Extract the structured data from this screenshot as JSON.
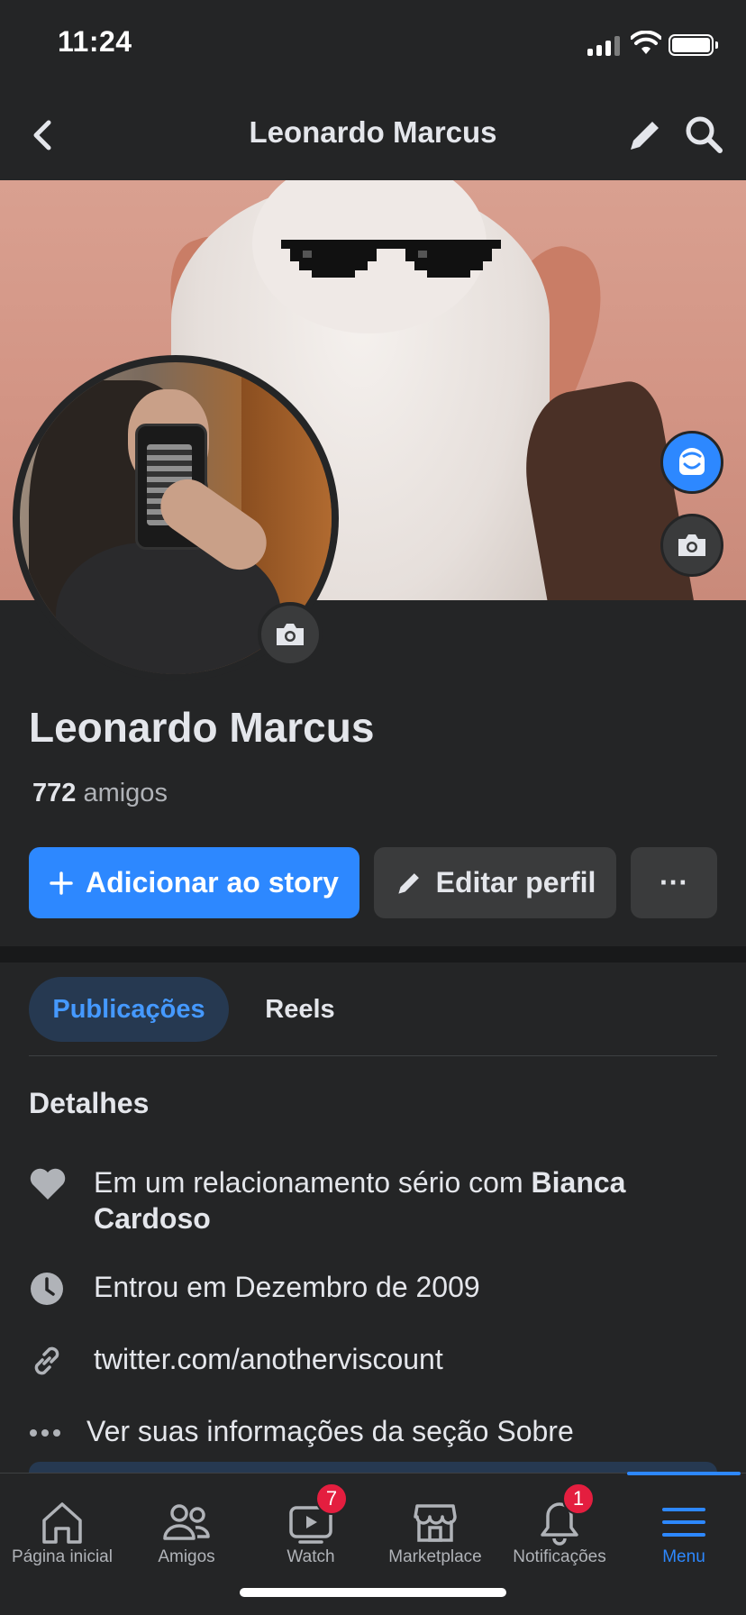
{
  "status_bar": {
    "time": "11:24"
  },
  "top_nav": {
    "title": "Leonardo Marcus",
    "back_icon": "chevron-left-icon",
    "edit_icon": "pencil-icon",
    "search_icon": "search-icon"
  },
  "profile": {
    "name": "Leonardo Marcus",
    "friends_count": "772",
    "friends_label": "amigos"
  },
  "actions": {
    "add_story_label": "Adicionar ao story",
    "edit_profile_label": "Editar perfil",
    "more_label": "···"
  },
  "tabs": [
    {
      "label": "Publicações",
      "active": true
    },
    {
      "label": "Reels",
      "active": false
    }
  ],
  "details": {
    "title": "Detalhes",
    "relationship_prefix": "Em um relacionamento sério com",
    "relationship_partner": "Bianca Cardoso",
    "joined": "Entrou em Dezembro de 2009",
    "link": "twitter.com/anotherviscount",
    "about": "Ver suas informações da seção Sobre"
  },
  "bottom_nav": [
    {
      "label": "Página inicial",
      "icon": "home-icon"
    },
    {
      "label": "Amigos",
      "icon": "friends-icon"
    },
    {
      "label": "Watch",
      "icon": "watch-icon",
      "badge": "7"
    },
    {
      "label": "Marketplace",
      "icon": "marketplace-icon"
    },
    {
      "label": "Notificações",
      "icon": "bell-icon",
      "badge": "1"
    },
    {
      "label": "Menu",
      "icon": "menu-icon",
      "active": true
    }
  ],
  "colors": {
    "accent": "#2d88ff",
    "background": "#242526",
    "badge": "#e41e3f"
  }
}
